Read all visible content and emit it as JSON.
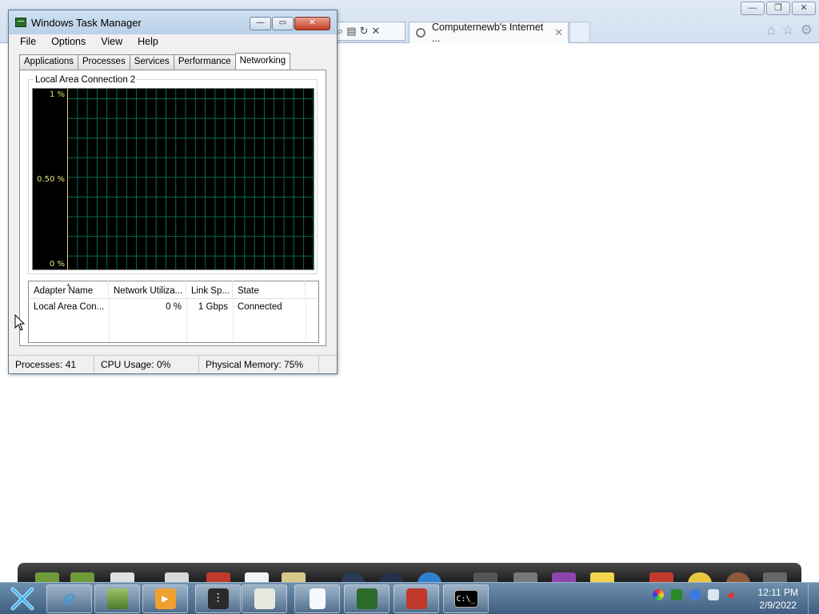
{
  "browser": {
    "tab_title": "Computernewb's Internet ...",
    "tab_close": "✕",
    "nav_search": "⌕",
    "nav_compat": "▤",
    "nav_refresh": "↻",
    "nav_stop": "✕",
    "tools": {
      "home": "⌂",
      "favorites": "☆",
      "settings": "⚙"
    },
    "caption": {
      "minimize": "—",
      "restore": "❐",
      "close": "✕"
    }
  },
  "task_manager": {
    "title": "Windows Task Manager",
    "caption": {
      "minimize": "—",
      "maximize": "▭",
      "close": "✕"
    },
    "menu": [
      "File",
      "Options",
      "View",
      "Help"
    ],
    "tabs": [
      "Applications",
      "Processes",
      "Services",
      "Performance",
      "Networking"
    ],
    "active_tab": "Networking",
    "graph": {
      "label": "Local Area Connection 2",
      "y_top": "1 %",
      "y_mid": "0.50 %",
      "y_bottom": "0 %"
    },
    "table": {
      "headers": [
        "Adapter Name",
        "Network Utiliza...",
        "Link Sp...",
        "State"
      ],
      "rows": [
        {
          "name": "Local Area Con...",
          "utilization": "0 %",
          "speed": "1 Gbps",
          "state": "Connected"
        }
      ]
    },
    "status": {
      "processes": "Processes: 41",
      "cpu": "CPU Usage: 0%",
      "memory": "Physical Memory: 75%"
    }
  },
  "taskbar": {
    "clock_time": "12:11 PM",
    "clock_date": "2/9/2022",
    "cmd_label": "C:\\_"
  }
}
